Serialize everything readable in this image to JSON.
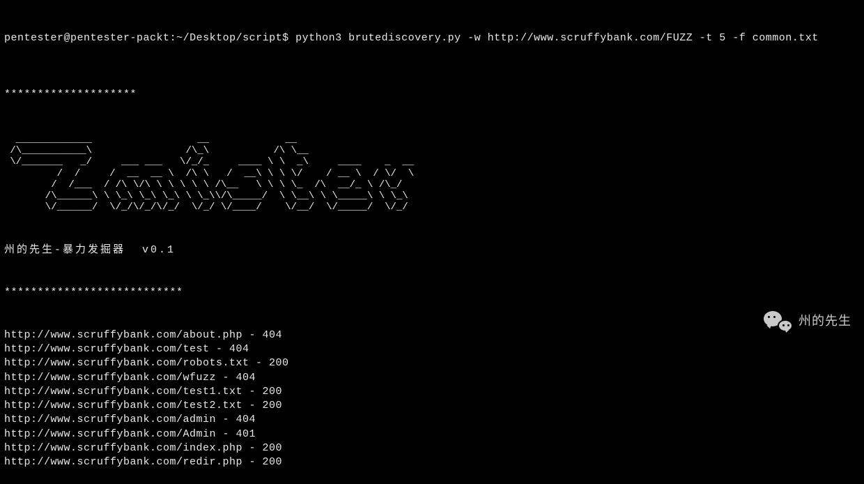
{
  "prompt": {
    "user": "pentester",
    "host": "pentester-packt",
    "cwd": "~/Desktop/script",
    "command": "python3 brutediscovery.py -w http://www.scruffybank.com/FUZZ -t 5 -f common.txt"
  },
  "separator_top": "********************",
  "ascii_art": "  _____________                  __             __                           \n /\\___________\\                /\\_\\           /\\ \\__                        \n \\/_______   _/     ___ ___   \\/_/_     ____ \\ \\  _\\     ____    _  __     \n         /  /     /  __  __ \\  /\\ \\   /  __\\ \\ \\ \\/    / __ \\  / \\/  \\   \n        /  /___  / /\\ \\/\\ \\ \\ \\ \\ \\ /\\__   \\ \\ \\ \\_  /\\  __/_ \\ /\\_/   \n       /\\______\\ \\ \\_\\ \\_\\ \\_\\ \\ \\_\\\\/\\_____/  \\ \\__\\ \\ \\_____\\ \\ \\_\\   \n       \\/______/  \\/_/\\/_/\\/_/  \\/_/ \\/____/    \\/__/  \\/_____/  \\/_/",
  "tool": {
    "title": "州的先生-暴力发掘器  v0.1"
  },
  "separator_mid": "***************************",
  "results": [
    {
      "url": "http://www.scruffybank.com/about.php",
      "status": "404"
    },
    {
      "url": "http://www.scruffybank.com/test",
      "status": "404"
    },
    {
      "url": "http://www.scruffybank.com/robots.txt",
      "status": "200"
    },
    {
      "url": "http://www.scruffybank.com/wfuzz",
      "status": "404"
    },
    {
      "url": "http://www.scruffybank.com/test1.txt",
      "status": "200"
    },
    {
      "url": "http://www.scruffybank.com/test2.txt",
      "status": "200"
    },
    {
      "url": "http://www.scruffybank.com/admin",
      "status": "404"
    },
    {
      "url": "http://www.scruffybank.com/Admin",
      "status": "401"
    },
    {
      "url": "http://www.scruffybank.com/index.php",
      "status": "200"
    },
    {
      "url": "http://www.scruffybank.com/redir.php",
      "status": "200"
    }
  ],
  "watermark": {
    "text": "州的先生"
  }
}
